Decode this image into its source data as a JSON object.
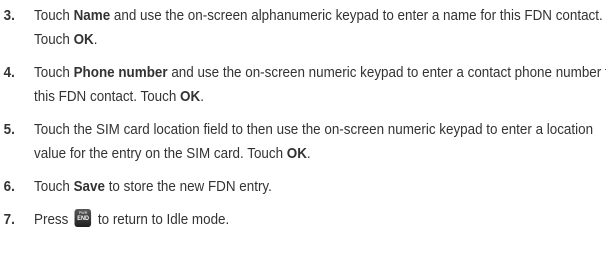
{
  "steps": [
    {
      "number": "3.",
      "t1": "Touch ",
      "b1": "Name",
      "t2": " and use the on-screen alphanumeric keypad to enter a name for this FDN contact. Touch ",
      "b2": "OK",
      "t3": "."
    },
    {
      "number": "4.",
      "t1": "Touch ",
      "b1": "Phone number",
      "t2": " and use the on-screen numeric keypad to enter a contact phone number for this FDN contact. Touch ",
      "b2": "OK",
      "t3": "."
    },
    {
      "number": "5.",
      "t1": "Touch the SIM card location field to then use the on-screen numeric keypad to enter a location value for the entry on the SIM card. Touch ",
      "b1": "OK",
      "t2": "."
    },
    {
      "number": "6.",
      "t1": "Touch ",
      "b1": "Save",
      "t2": " to store the new FDN entry."
    },
    {
      "number": "7.",
      "t1": "Press ",
      "key_icon": "end-power-key-icon",
      "key_text_top": "PWR",
      "key_text_main": "END",
      "t2": " to return to Idle mode."
    }
  ]
}
